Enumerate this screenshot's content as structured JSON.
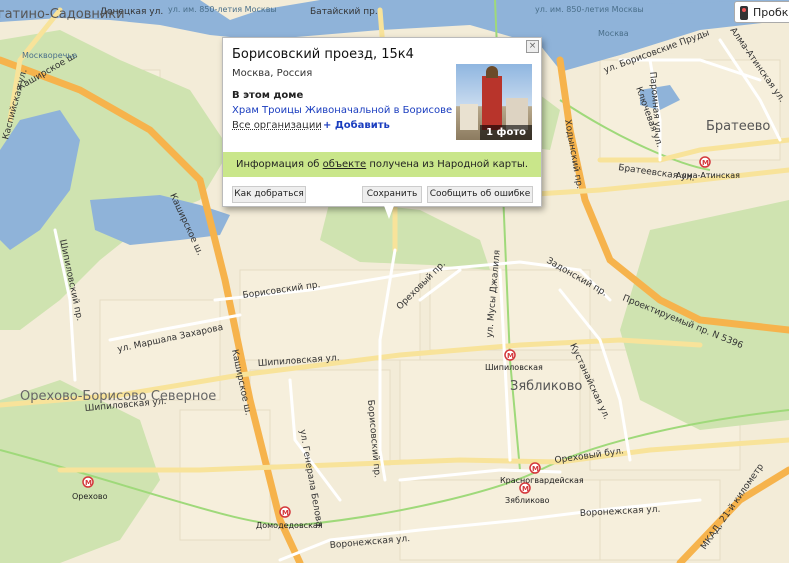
{
  "map": {
    "colors": {
      "background": "#f3ecd8",
      "block": "#f6efdc",
      "water": "#8fb3d9",
      "park": "#cfe3b0",
      "highway": "#f6b34c",
      "major_road": "#f8e39a",
      "street": "#ffffff",
      "metro_line": "#9fd97a",
      "metro_marker": "#d4373b"
    },
    "road_labels": [
      "Донецкая ул.",
      "Батайский пр.",
      "Каширское ш.",
      "Каспийская ул.",
      "Каширское ш.",
      "Шипиловский пр.",
      "Борисовский пр.",
      "ул. Маршала Захарова",
      "Шипиловская ул.",
      "Каширское ш.",
      "Шипиловская ул.",
      "Ореховый пр.",
      "ул. Мусы Джалиля",
      "Задонский пр.",
      "Ходынский пр.",
      "Кустанайская ул.",
      "Проектируемый пр. N 5396",
      "Борисовский пр.",
      "ул. Генерала Белова",
      "Ореховый бул.",
      "Воронежская ул.",
      "Воронежская ул.",
      "МКАД, 21-й километр",
      "ул. Борисовские Пруды",
      "Паромная ул.",
      "Ключевая ул.",
      "Братеевская ул.",
      "Алма-Атинская ул."
    ],
    "small_labels": [
      "Москворечье",
      "ул. им. 850-летия Москвы",
      "ул. им. 850-летия Москвы",
      "Москва"
    ],
    "districts": [
      "Нагатино-Садовники",
      "Братеево",
      "Зябликово",
      "Орехово-Борисово Северное"
    ],
    "metro_stations": [
      "Алма-Атинская",
      "Шипиловская",
      "Красногвардейская",
      "Зябликово",
      "Орехово",
      "Домодедовская"
    ]
  },
  "traffic_button": {
    "label": "Пробки"
  },
  "balloon": {
    "title": "Борисовский проезд, 15к4",
    "subtitle": "Москва, Россия",
    "section_heading": "В этом доме",
    "organization": "Храм Троицы Живоначальной в Борисове",
    "all_orgs_link": "Все организации",
    "add_link": "+ Добавить",
    "photo_caption": "1 фото",
    "info_prefix": "Информация об ",
    "info_link": "объекте",
    "info_suffix": " получена из Народной карты.",
    "buttons": {
      "route": "Как добраться",
      "save": "Сохранить",
      "report": "Сообщить об ошибке"
    },
    "close_icon": "close-icon"
  }
}
